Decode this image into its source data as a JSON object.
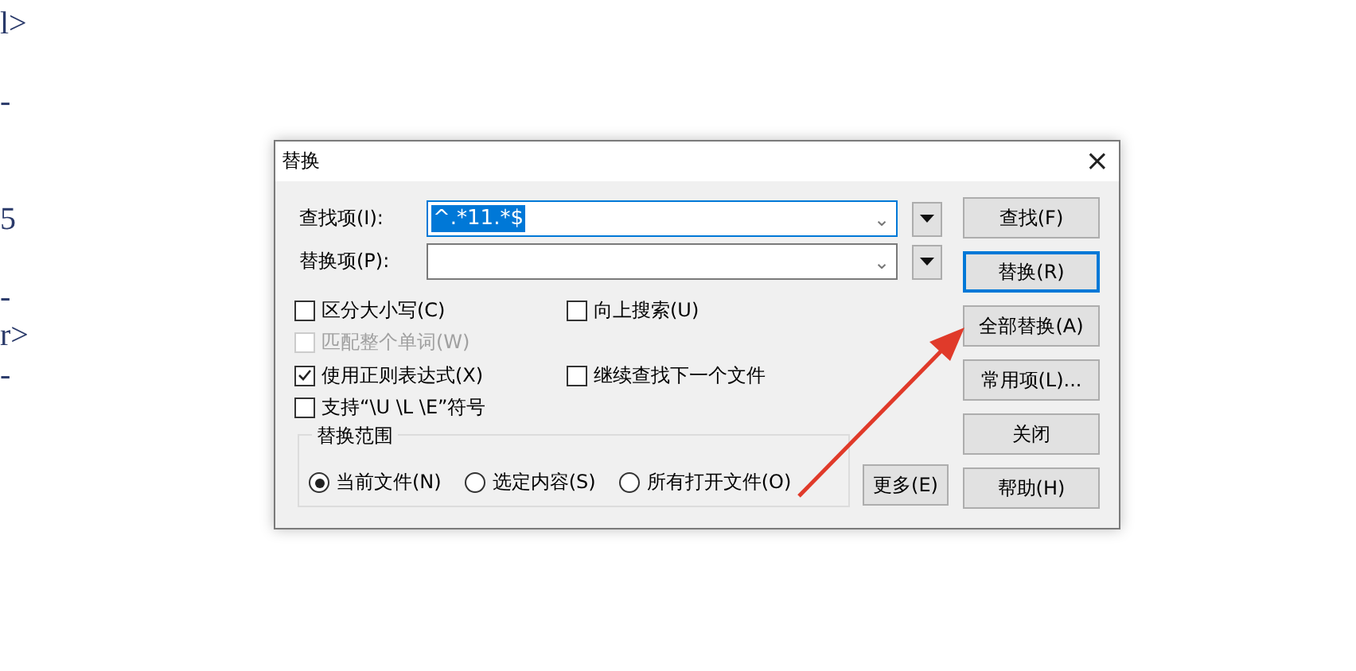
{
  "editor": {
    "lines": [
      {
        "kind": "text",
        "text": "l>"
      },
      {
        "kind": "blank"
      },
      {
        "kind": "text",
        "text": "-"
      },
      {
        "kind": "blank"
      },
      {
        "kind": "blank"
      },
      {
        "kind": "text",
        "text": "5"
      },
      {
        "kind": "blank"
      },
      {
        "kind": "text",
        "text": "-"
      },
      {
        "kind": "text",
        "text": "r>"
      },
      {
        "kind": "text",
        "text": "-"
      }
    ]
  },
  "dialog": {
    "title": "替换",
    "close": "×",
    "fields": [
      {
        "label": "查找项(I):",
        "value": "^.*11.*$",
        "text_selected": true,
        "focused": true,
        "caret": "⌄"
      },
      {
        "label": "替换项(P):",
        "focused": false,
        "caret": "⌄"
      }
    ],
    "option_rows": [
      [
        {
          "label": "区分大小写(C)",
          "checked": false,
          "disabled": false
        },
        {
          "label": "向上搜索(U)",
          "checked": false,
          "disabled": false
        }
      ],
      [
        {
          "label": "匹配整个单词(W)",
          "checked": false,
          "disabled": true
        }
      ],
      [
        {
          "label": "使用正则表达式(X)",
          "checked": true,
          "disabled": false
        },
        {
          "label": "继续查找下一个文件",
          "checked": false,
          "disabled": false
        }
      ],
      [
        {
          "label": "支持“\\U \\L \\E”符号",
          "checked": false,
          "disabled": false
        }
      ]
    ],
    "scope": {
      "title": "替换范围",
      "options": [
        {
          "label": "当前文件(N)",
          "selected": true
        },
        {
          "label": "选定内容(S)",
          "selected": false
        },
        {
          "label": "所有打开文件(O)",
          "selected": false
        }
      ]
    },
    "more_button": "更多(E)",
    "buttons": [
      {
        "label": "查找(F)",
        "focused": false
      },
      {
        "label": "替换(R)",
        "focused": true
      },
      {
        "label": "全部替换(A)",
        "focused": false
      },
      {
        "label": "常用项(L)...",
        "focused": false
      },
      {
        "label": "关闭",
        "focused": false
      },
      {
        "label": "帮助(H)",
        "focused": false
      }
    ]
  }
}
